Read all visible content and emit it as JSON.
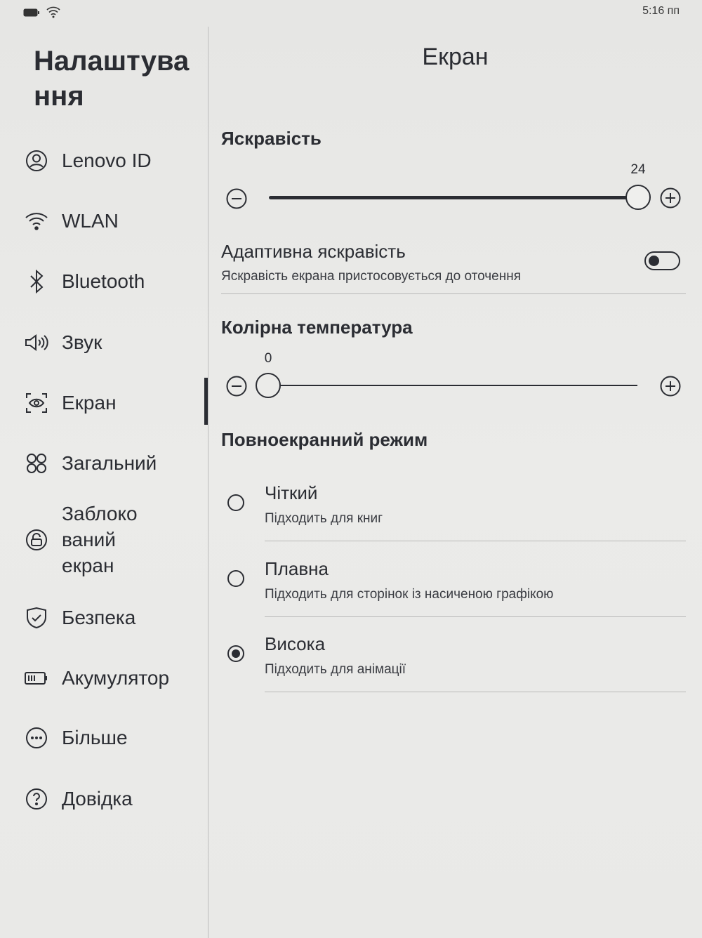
{
  "status_bar": {
    "time": "5:16 пп",
    "icons": [
      "battery-icon",
      "wifi-icon"
    ]
  },
  "sidebar": {
    "title": "Налаштування",
    "active_index": 4,
    "items": [
      {
        "label": "Lenovo ID",
        "icon": "user-circle-icon"
      },
      {
        "label": "WLAN",
        "icon": "wifi-icon"
      },
      {
        "label": "Bluetooth",
        "icon": "bluetooth-icon"
      },
      {
        "label": "Звук",
        "icon": "speaker-icon"
      },
      {
        "label": "Екран",
        "icon": "eye-screen-icon"
      },
      {
        "label": "Загальний",
        "icon": "grid-icon"
      },
      {
        "label": "Заблоко\nваний\nекран",
        "icon": "lock-circle-icon"
      },
      {
        "label": "Безпека",
        "icon": "shield-check-icon"
      },
      {
        "label": "Акумулятор",
        "icon": "battery-icon"
      },
      {
        "label": "Більше",
        "icon": "more-circle-icon"
      },
      {
        "label": "Довідка",
        "icon": "help-circle-icon"
      }
    ]
  },
  "main": {
    "title": "Екран",
    "brightness": {
      "heading": "Яскравість",
      "value": "24",
      "fraction": 1.0
    },
    "adaptive": {
      "title": "Адаптивна яскравість",
      "subtitle": "Яскравість екрана пристосовується до оточення",
      "enabled": false
    },
    "color_temp": {
      "heading": "Колірна температура",
      "value": "0",
      "fraction": 0.0
    },
    "fullscreen": {
      "heading": "Повноекранний режим",
      "options": [
        {
          "title": "Чіткий",
          "subtitle": "Підходить для книг",
          "selected": false
        },
        {
          "title": "Плавна",
          "subtitle": "Підходить для сторінок із насиченою графікою",
          "selected": false
        },
        {
          "title": "Висока",
          "subtitle": "Підходить для анімації",
          "selected": true
        }
      ]
    }
  },
  "colors": {
    "text": "#2b2d33",
    "background": "#e8e8e6"
  }
}
